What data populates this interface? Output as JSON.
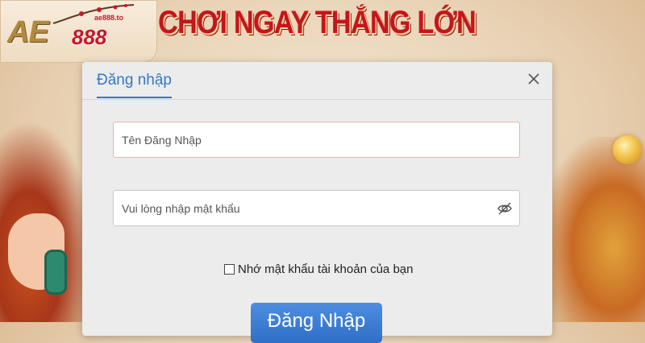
{
  "brand": {
    "logo_main": "AE",
    "logo_number": "888",
    "logo_domain": "ae888.to",
    "banner_title": "CHƠI NGAY THẮNG LỚN"
  },
  "modal": {
    "tab_label": "Đăng nhập",
    "close_icon": "close-icon",
    "username_placeholder": "Tên Đăng Nhập",
    "password_placeholder": "Vui lòng nhập mật khẩu",
    "eye_icon": "eye-off-icon",
    "remember_label": "Nhớ mật khẩu tài khoản của bạn",
    "remember_checked": false,
    "login_button": "Đăng Nhập"
  },
  "colors": {
    "accent": "#3278c8",
    "banner_red": "#c4161c",
    "button_blue": "#3a7fd6"
  }
}
